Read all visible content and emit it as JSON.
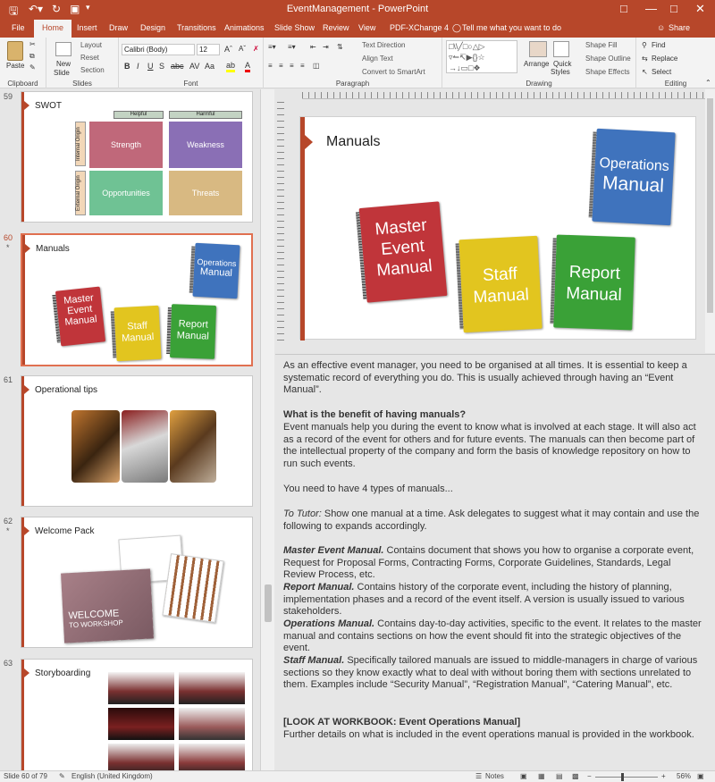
{
  "titlebar": {
    "title": "EventManagement - PowerPoint"
  },
  "tabs": [
    "File",
    "Home",
    "Insert",
    "Draw",
    "Design",
    "Transitions",
    "Animations",
    "Slide Show",
    "Review",
    "View",
    "PDF-XChange 4"
  ],
  "tell_me": "Tell me what you want to do",
  "share": "Share",
  "ribbon": {
    "clipboard": {
      "paste": "Paste",
      "label": "Clipboard"
    },
    "slides": {
      "new_slide": "New",
      "new_slide2": "Slide",
      "layout": "Layout",
      "reset": "Reset",
      "section": "Section",
      "label": "Slides"
    },
    "font": {
      "name": "Calibri (Body)",
      "size": "12",
      "label": "Font",
      "aa": "Aa"
    },
    "paragraph": {
      "text_direction": "Text Direction",
      "align_text": "Align Text",
      "convert": "Convert to SmartArt",
      "label": "Paragraph"
    },
    "drawing": {
      "arrange": "Arrange",
      "quick_styles": "Quick",
      "quick_styles2": "Styles",
      "shape_fill": "Shape Fill",
      "shape_outline": "Shape Outline",
      "shape_effects": "Shape Effects",
      "label": "Drawing"
    },
    "editing": {
      "find": "Find",
      "replace": "Replace",
      "select": "Select",
      "label": "Editing"
    }
  },
  "thumbnails": [
    {
      "num": "59",
      "star": "",
      "title": "SWOT",
      "helpful": "Helpful",
      "harmful": "Harmful",
      "internal": "Internal Origin",
      "external": "External Origin",
      "cells": [
        "Strength",
        "Weakness",
        "Opportunities",
        "Threats"
      ]
    },
    {
      "num": "60",
      "star": "*",
      "title": "Manuals"
    },
    {
      "num": "61",
      "star": "",
      "title": "Operational tips"
    },
    {
      "num": "62",
      "star": "*",
      "title": "Welcome Pack",
      "welcome": "WELCOME",
      "to_workshop": "TO WORKSHOP"
    },
    {
      "num": "63",
      "star": "",
      "title": "Storyboarding"
    }
  ],
  "slide": {
    "title": "Manuals",
    "books": [
      {
        "label": "Operations Manual",
        "line1": "Operations",
        "line2": "Manual",
        "color": "#3f73bd"
      },
      {
        "label": "Master Event Manual",
        "line1": "Master",
        "line2": "Event",
        "line3": "Manual",
        "color": "#c0353a"
      },
      {
        "label": "Staff Manual",
        "line1": "Staff",
        "line2": "Manual",
        "color": "#e2c51f"
      },
      {
        "label": "Report Manual",
        "line1": "Report",
        "line2": "Manual",
        "color": "#3aa137"
      }
    ]
  },
  "notes": {
    "p1": "As an effective event manager, you need to be organised at all times. It is essential to keep a systematic record of everything you do. This is usually achieved through having an “Event Manual”.",
    "h1": "What is the benefit of having manuals?",
    "p2": "Event manuals help you during the event to know what is involved at each stage. It will also act as a record of the event for others and for future events. The manuals can then become part of the intellectual property of the company and form the basis of knowledge repository on how to run such events.",
    "p3": "You need to have 4 types of manuals...",
    "tutor_label": "To Tutor:",
    "tutor_text": " Show one manual at a time. Ask delegates to suggest what it may contain and use the following to expands accordingly.",
    "m1_label": "Master Event Manual.",
    "m1_text": " Contains document that shows you how to organise a corporate event, Request for Proposal Forms, Contracting Forms, Corporate Guidelines, Standards, Legal Review Process, etc.",
    "m2_label": "Report Manual.",
    "m2_text": " Contains history of the corporate event, including the history of planning, implementation phases and a record of the event itself. A version is usually issued to various stakeholders.",
    "m3_label": "Operations Manual.",
    "m3_text": " Contains day-to-day activities, specific to the event. It relates to the master manual and contains sections on how the event should fit into the strategic objectives of the event.",
    "m4_label": "Staff Manual.",
    "m4_text": " Specifically tailored manuals are issued to middle-managers in charge of various sections so they know exactly what to deal with without boring them with sections unrelated to them.  Examples include “Security Manual”, “Registration Manual”, “Catering Manual”, etc.",
    "h2": "[LOOK AT WORKBOOK: Event Operations Manual]",
    "p4": "Further details on what is included in the event operations manual is provided in the workbook."
  },
  "status": {
    "slide": "Slide 60 of 79",
    "language": "English (United Kingdom)",
    "notes": "Notes",
    "zoom": "56%"
  },
  "colors": {
    "accent": "#b7472a"
  }
}
